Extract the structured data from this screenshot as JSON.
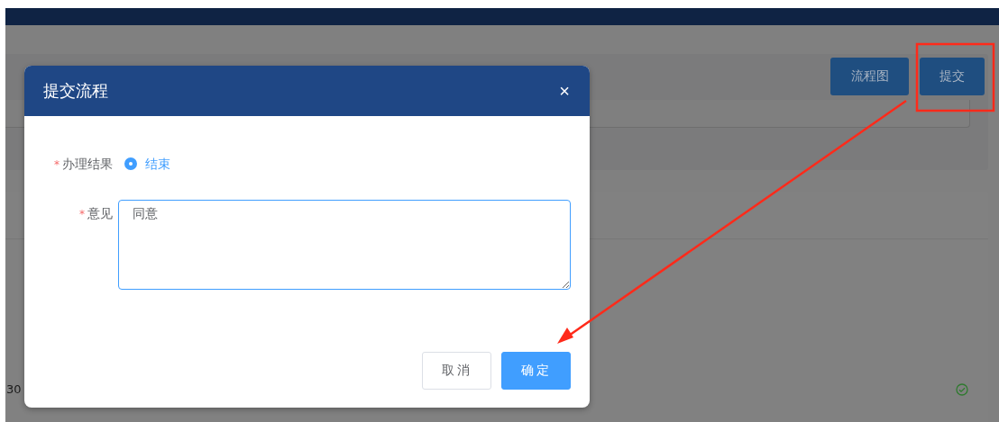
{
  "page": {
    "toolbar_buttons": [
      {
        "label": "流程图"
      },
      {
        "label": "提交"
      }
    ],
    "row_text": "30"
  },
  "dialog": {
    "title": "提交流程",
    "close": "×",
    "result": {
      "label": "办理结果",
      "required_mark": "*",
      "options": [
        {
          "label": "结束",
          "selected": true
        }
      ]
    },
    "opinion": {
      "label": "意见",
      "required_mark": "*",
      "value": "同意"
    },
    "buttons": [
      {
        "label": "取消",
        "kind": "secondary"
      },
      {
        "label": "确定",
        "kind": "primary"
      }
    ]
  }
}
